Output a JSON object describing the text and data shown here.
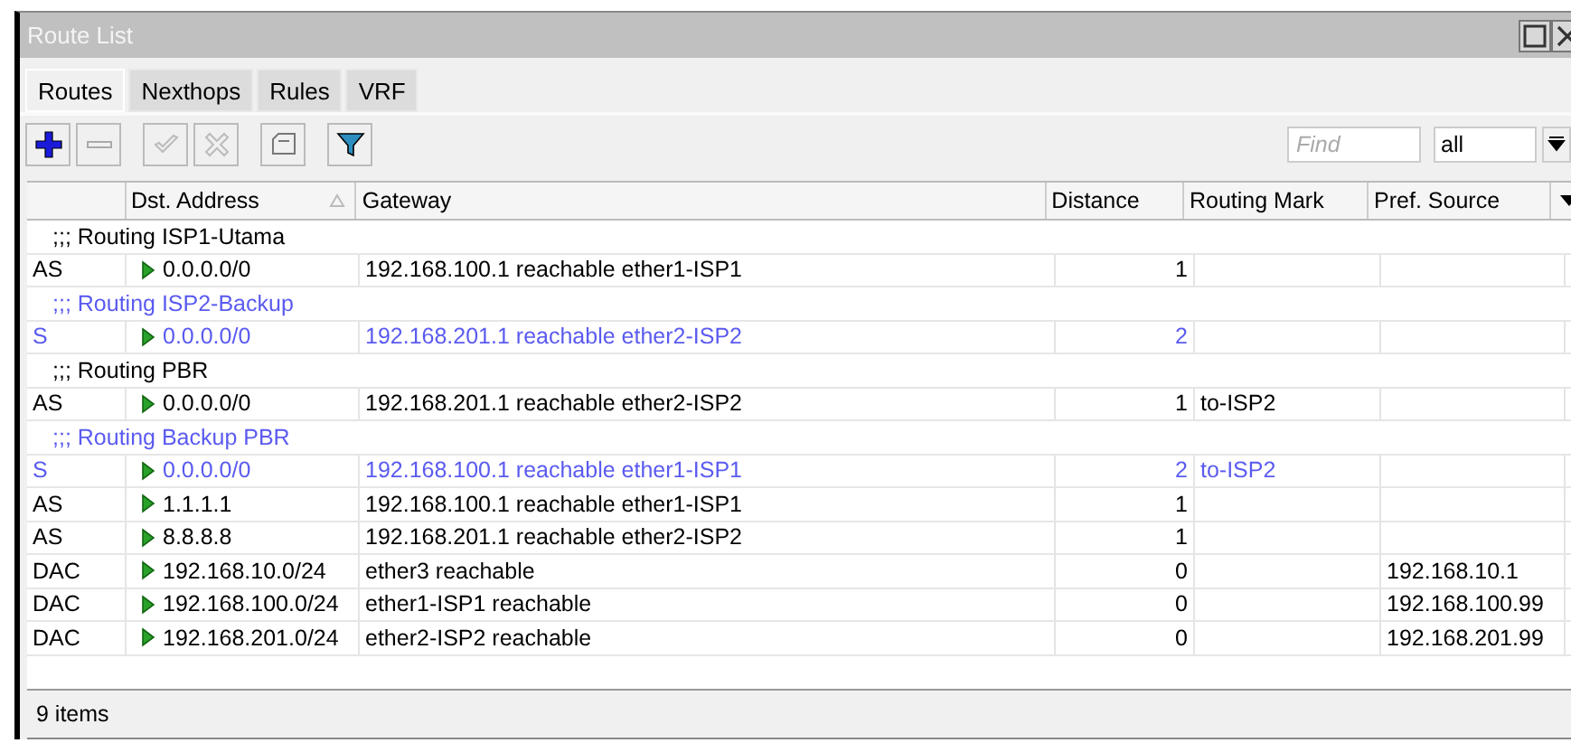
{
  "window": {
    "title": "Route List"
  },
  "tabs": [
    {
      "label": "Routes",
      "selected": true
    },
    {
      "label": "Nexthops",
      "selected": false
    },
    {
      "label": "Rules",
      "selected": false
    },
    {
      "label": "VRF",
      "selected": false
    }
  ],
  "toolbar": {
    "find_placeholder": "Find",
    "filter_value": "all"
  },
  "table": {
    "columns": [
      "",
      "Dst. Address",
      "Gateway",
      "Distance",
      "Routing Mark",
      "Pref. Source"
    ],
    "rows": [
      {
        "kind": "comment",
        "text": ";;; Routing ISP1-Utama",
        "active": true
      },
      {
        "kind": "route",
        "active": true,
        "flags": "AS",
        "dst": "0.0.0.0/0",
        "gateway": "192.168.100.1 reachable ether1-ISP1",
        "distance": "1",
        "mark": "",
        "pref": ""
      },
      {
        "kind": "comment",
        "text": ";;; Routing ISP2-Backup",
        "active": false
      },
      {
        "kind": "route",
        "active": false,
        "flags": "S",
        "dst": "0.0.0.0/0",
        "gateway": "192.168.201.1 reachable ether2-ISP2",
        "distance": "2",
        "mark": "",
        "pref": ""
      },
      {
        "kind": "comment",
        "text": ";;; Routing PBR",
        "active": true
      },
      {
        "kind": "route",
        "active": true,
        "flags": "AS",
        "dst": "0.0.0.0/0",
        "gateway": "192.168.201.1 reachable ether2-ISP2",
        "distance": "1",
        "mark": "to-ISP2",
        "pref": ""
      },
      {
        "kind": "comment",
        "text": ";;; Routing Backup PBR",
        "active": false
      },
      {
        "kind": "route",
        "active": false,
        "flags": "S",
        "dst": "0.0.0.0/0",
        "gateway": "192.168.100.1 reachable ether1-ISP1",
        "distance": "2",
        "mark": "to-ISP2",
        "pref": ""
      },
      {
        "kind": "route",
        "active": true,
        "flags": "AS",
        "dst": "1.1.1.1",
        "gateway": "192.168.100.1 reachable ether1-ISP1",
        "distance": "1",
        "mark": "",
        "pref": ""
      },
      {
        "kind": "route",
        "active": true,
        "flags": "AS",
        "dst": "8.8.8.8",
        "gateway": "192.168.201.1 reachable ether2-ISP2",
        "distance": "1",
        "mark": "",
        "pref": ""
      },
      {
        "kind": "route",
        "active": true,
        "flags": "DAC",
        "dst": "192.168.10.0/24",
        "gateway": "ether3 reachable",
        "distance": "0",
        "mark": "",
        "pref": "192.168.10.1"
      },
      {
        "kind": "route",
        "active": true,
        "flags": "DAC",
        "dst": "192.168.100.0/24",
        "gateway": "ether1-ISP1 reachable",
        "distance": "0",
        "mark": "",
        "pref": "192.168.100.99"
      },
      {
        "kind": "route",
        "active": true,
        "flags": "DAC",
        "dst": "192.168.201.0/24",
        "gateway": "ether2-ISP2 reachable",
        "distance": "0",
        "mark": "",
        "pref": "192.168.201.99"
      }
    ]
  },
  "status_bar": "9 items"
}
